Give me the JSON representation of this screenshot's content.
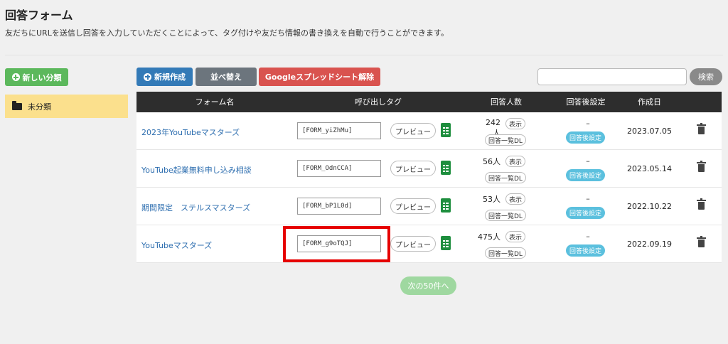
{
  "page": {
    "title": "回答フォーム",
    "description": "友だちにURLを送信し回答を入力していただくことによって、タグ付けや友だち情報の書き換えを自動で行うことができます。"
  },
  "sidebar": {
    "new_category_label": "新しい分類",
    "categories": [
      {
        "label": "未分類"
      }
    ]
  },
  "toolbar": {
    "new_label": "新規作成",
    "sort_label": "並べ替え",
    "google_label": "Googleスプレッドシート解除",
    "search_placeholder": "",
    "search_label": "検索"
  },
  "table": {
    "headers": {
      "name": "フォーム名",
      "tag": "呼び出しタグ",
      "count": "回答人数",
      "after": "回答後設定",
      "date": "作成日"
    },
    "preview_label": "プレビュー",
    "show_label": "表示",
    "dl_label": "回答一覧DL",
    "dash": "–",
    "setting_label": "回答後設定",
    "rows": [
      {
        "name": "2023年YouTubeマスターズ",
        "tag": "[FORM_yiZhMu]",
        "count": "242人",
        "date": "2023.07.05"
      },
      {
        "name": "YouTube起業無料申し込み相談",
        "tag": "[FORM_OdnCCA]",
        "count": "56人",
        "date": "2023.05.14"
      },
      {
        "name": "期間限定　ステルスマスターズ",
        "tag": "[FORM_bP1L0d]",
        "count": "53人",
        "date": "2022.10.22"
      },
      {
        "name": "YouTubeマスターズ",
        "tag": "[FORM_g9oTQJ]",
        "count": "475人",
        "date": "2022.09.19"
      }
    ]
  },
  "pagination": {
    "next_label": "次の50件へ"
  },
  "colors": {
    "highlight": "#e60000",
    "header_bg": "#2d2d2d",
    "category_bg": "#fbe08d",
    "link": "#2f6fb0"
  }
}
